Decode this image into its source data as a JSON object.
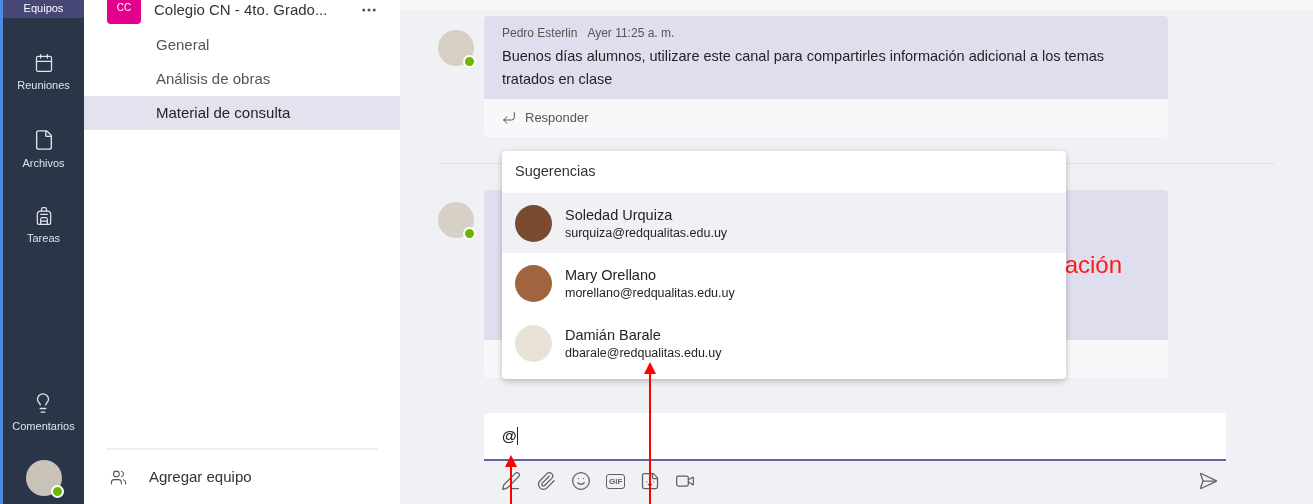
{
  "rail": {
    "items": [
      {
        "label": "Equipos",
        "selected": true
      },
      {
        "label": "Reuniones",
        "selected": false
      },
      {
        "label": "Archivos",
        "selected": false
      },
      {
        "label": "Tareas",
        "selected": false
      }
    ],
    "feedback": "Comentarios"
  },
  "team": {
    "initials": "CC",
    "name": "Colegio CN - 4to. Grado..."
  },
  "channels": [
    {
      "name": "General",
      "selected": false
    },
    {
      "name": "Análisis de obras",
      "selected": false
    },
    {
      "name": "Material de consulta",
      "selected": true
    }
  ],
  "add_team": "Agregar equipo",
  "messages": [
    {
      "author": "Pedro Esterlin",
      "time": "Ayer 11:25 a. m.",
      "body": "Buenos días alumnos, utilizare este canal para compartirles información adicional a los temas tratados en clase",
      "reply": "Responder"
    },
    {
      "body": "ación"
    }
  ],
  "suggestions": {
    "title": "Sugerencias",
    "people": [
      {
        "name": "Soledad Urquiza",
        "email": "surquiza@redqualitas.edu.uy",
        "selected": true
      },
      {
        "name": "Mary Orellano",
        "email": "morellano@redqualitas.edu.uy",
        "selected": false
      },
      {
        "name": "Damián Barale",
        "email": "dbarale@redqualitas.edu.uy",
        "selected": false
      }
    ]
  },
  "compose": {
    "value": "@",
    "gif_label": "GIF"
  }
}
